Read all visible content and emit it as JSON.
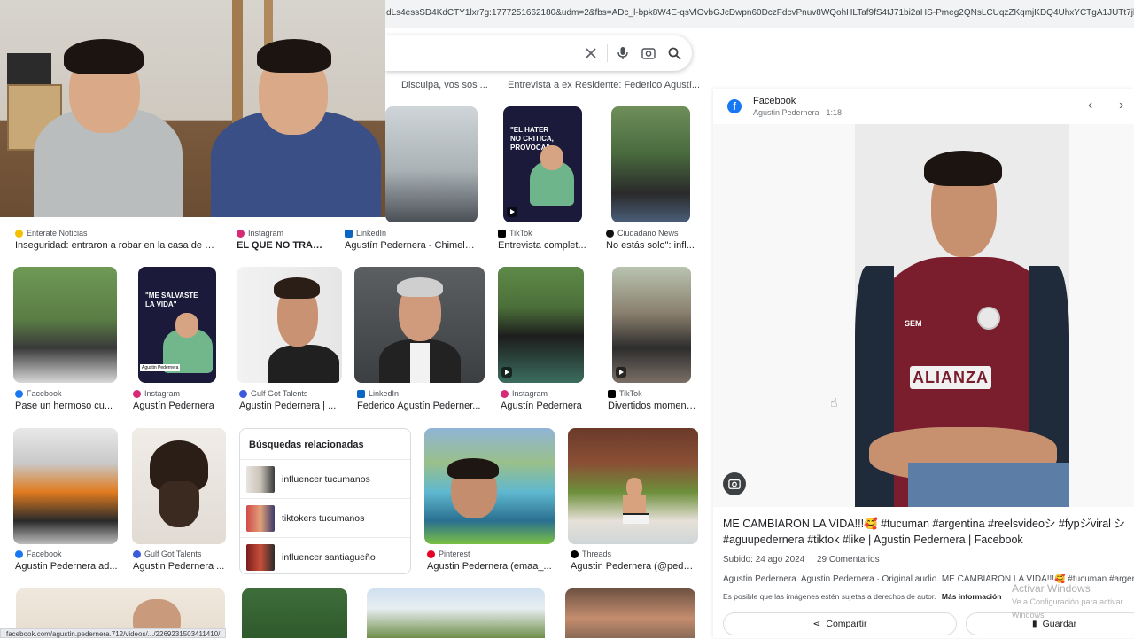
{
  "browser": {
    "url_fragment": "dLs4essSD4KdCTY1lxr7g:1777251662180&udm=2&fbs=ADc_l-bpk8W4E-qsVlOvbGJcDwpn60DczFdcvPnuv8WQohHLTaf9fS4tJ71bi2aHS-Pmeg2QNsLCUqzZKqmjKDQ4UhxYCTgA1JUTt7jl4E",
    "status_url": "facebook.com/agustin.pedernera.712/videos/.../2269231503411410/"
  },
  "search": {
    "clear_icon": "close-icon",
    "voice_icon": "microphone-icon",
    "lens_icon": "lens-icon",
    "search_icon": "search-icon"
  },
  "top_captions": [
    "Disculpa, vos sos ...",
    "Entrevista a ex Residente: Federico Agustí..."
  ],
  "row1": [
    {
      "source": "Enterate Noticias",
      "title": "Inseguridad: entraron a robar en la casa de un...",
      "bold": false,
      "color": "#f2c200"
    },
    {
      "source": "Instagram",
      "title": "EL QUE NO TRABAJ...",
      "bold": true,
      "color": "#d62976"
    },
    {
      "source": "LinkedIn",
      "title": "Agustín Pedernera - Chimelon...",
      "bold": false,
      "color": "#0a66c2"
    },
    {
      "source": "TikTok",
      "title": "Entrevista complet...",
      "bold": false,
      "color": "#000000"
    },
    {
      "source": "Ciudadano News",
      "title": "No estás solo\": infl...",
      "bold": false,
      "color": "#111111"
    }
  ],
  "tile_texts": {
    "hater": "\"EL HATER NO CRITICA, PROVOCA\"",
    "salvaste": "\"ME SALVASTE LA VIDA\"",
    "brand": "Agustin Pedernera"
  },
  "row2": [
    {
      "source": "Facebook",
      "title": "Pase un hermoso cu...",
      "color": "#1877f2"
    },
    {
      "source": "Instagram",
      "title": "Agustín Pedernera",
      "color": "#d62976"
    },
    {
      "source": "Gulf Got Talents",
      "title": "Agustin Pedernera | ...",
      "color": "#3b5bdb"
    },
    {
      "source": "LinkedIn",
      "title": "Federico Agustín Pederner...",
      "color": "#0a66c2"
    },
    {
      "source": "Instagram",
      "title": "Agustín Pedernera",
      "color": "#d62976"
    },
    {
      "source": "TikTok",
      "title": "Divertidos moment...",
      "color": "#000000"
    }
  ],
  "row3": [
    {
      "source": "Facebook",
      "title": "Agustin Pedernera ad...",
      "color": "#1877f2"
    },
    {
      "source": "Gulf Got Talents",
      "title": "Agustin Pedernera ...",
      "color": "#3b5bdb"
    },
    {
      "source": "Pinterest",
      "title": "Agustin Pedernera (emaa_...",
      "color": "#e60023"
    },
    {
      "source": "Threads",
      "title": "Agustin Pedernera (@peder...",
      "color": "#000000"
    }
  ],
  "related": {
    "heading": "Búsquedas relacionadas",
    "items": [
      "influencer tucumanos",
      "tiktokers tucumanos",
      "influencer santiagueño"
    ]
  },
  "panel": {
    "source": "Facebook",
    "subtitle": "Agustin Pedernera · 1:18",
    "jersey_text": "ALIANZA",
    "jersey_small": "SEM",
    "title": "ME CAMBIARON LA VIDA!!!🥰 #tucuman #argentina #reelsvideoシ #fypシ゚viral シ #aguupedernera #tiktok #like | Agustin Pedernera | Facebook",
    "uploaded": "Subido: 24 ago 2024",
    "comments": "29 Comentarios",
    "credits": "Agustin Pedernera. Agustin Pedernera · Original audio. ME CAMBIARON LA VIDA!!!🥰 #tucuman #argentina",
    "copyright": "Es posible que las imágenes estén sujetas a derechos de autor.",
    "more_info": "Más información",
    "share": "Compartir",
    "save": "Guardar"
  },
  "watermark": {
    "line1": "Activar Windows",
    "line2": "Ve a Configuración para activar Windows."
  }
}
